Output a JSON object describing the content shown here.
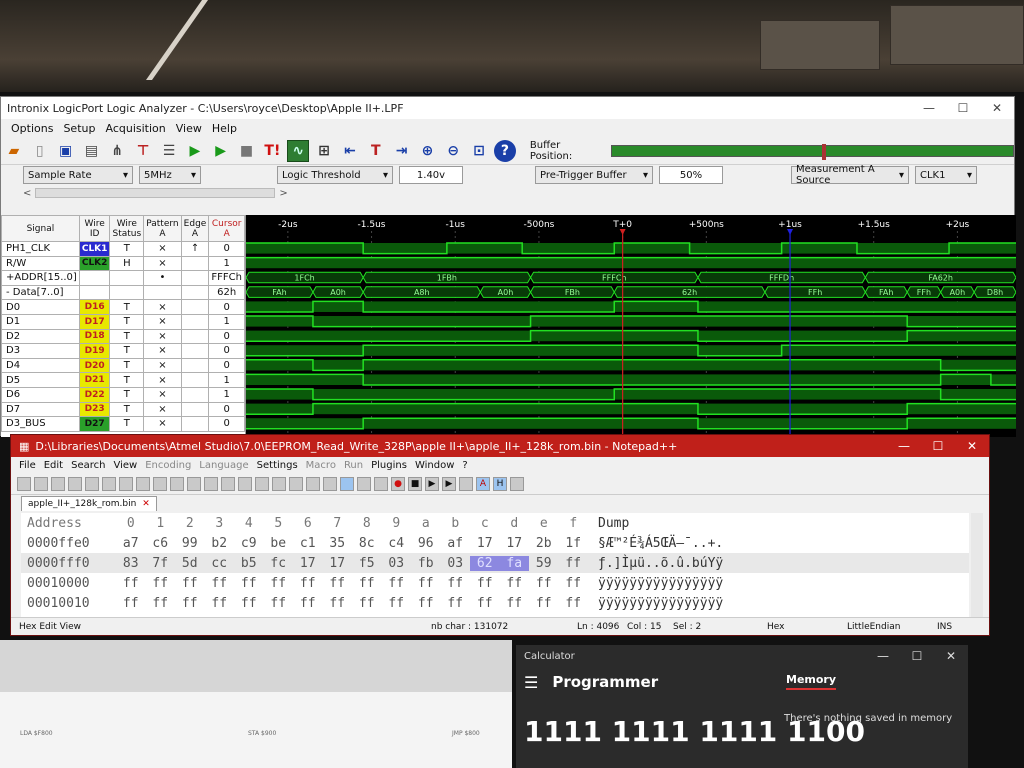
{
  "logic_analyzer": {
    "title": "Intronix LogicPort Logic Analyzer - C:\\Users\\royce\\Desktop\\Apple II+.LPF",
    "menu": [
      "Options",
      "Setup",
      "Acquisition",
      "View",
      "Help"
    ],
    "buffer_position_label": "Buffer Position:",
    "controls": {
      "sample_rate_label": "Sample Rate",
      "sample_rate_value": "5MHz",
      "logic_threshold_label": "Logic Threshold",
      "logic_threshold_value": "1.40v",
      "pretrigger_label": "Pre-Trigger Buffer",
      "pretrigger_value": "50%",
      "measurement_label": "Measurement A Source",
      "measurement_value": "CLK1"
    },
    "time_axis": [
      "-2us",
      "-1.5us",
      "-1us",
      "-500ns",
      "T+0",
      "+500ns",
      "+1us",
      "+1.5us",
      "+2us"
    ],
    "columns": [
      "Signal",
      "Wire ID",
      "Wire Status",
      "Pattern A",
      "Edge A",
      "Cursor A"
    ],
    "signals": [
      {
        "name": "PH1_CLK",
        "wire": "CLK1",
        "status": "T",
        "pattern": "×",
        "edge": "↑",
        "cursor": "0",
        "wire_color": "#2a2ad0"
      },
      {
        "name": "R/W",
        "wire": "CLK2",
        "status": "H",
        "pattern": "×",
        "edge": "",
        "cursor": "1",
        "wire_color": "#2aa02a"
      },
      {
        "name": "+ADDR[15..0]",
        "wire": "",
        "status": "",
        "pattern": "•",
        "edge": "",
        "cursor": "FFFCh",
        "wire_color": ""
      },
      {
        "name": "- Data[7..0]",
        "wire": "",
        "status": "",
        "pattern": "",
        "edge": "",
        "cursor": "62h",
        "wire_color": ""
      },
      {
        "name": "D0",
        "wire": "D16",
        "status": "T",
        "pattern": "×",
        "edge": "",
        "cursor": "0",
        "wire_color": "#e8e800"
      },
      {
        "name": "D1",
        "wire": "D17",
        "status": "T",
        "pattern": "×",
        "edge": "",
        "cursor": "1",
        "wire_color": "#e8e800"
      },
      {
        "name": "D2",
        "wire": "D18",
        "status": "T",
        "pattern": "×",
        "edge": "",
        "cursor": "0",
        "wire_color": "#e8e800"
      },
      {
        "name": "D3",
        "wire": "D19",
        "status": "T",
        "pattern": "×",
        "edge": "",
        "cursor": "0",
        "wire_color": "#e8e800"
      },
      {
        "name": "D4",
        "wire": "D20",
        "status": "T",
        "pattern": "×",
        "edge": "",
        "cursor": "0",
        "wire_color": "#e8e800"
      },
      {
        "name": "D5",
        "wire": "D21",
        "status": "T",
        "pattern": "×",
        "edge": "",
        "cursor": "1",
        "wire_color": "#e8e800"
      },
      {
        "name": "D6",
        "wire": "D22",
        "status": "T",
        "pattern": "×",
        "edge": "",
        "cursor": "1",
        "wire_color": "#e8e800"
      },
      {
        "name": "D7",
        "wire": "D23",
        "status": "T",
        "pattern": "×",
        "edge": "",
        "cursor": "0",
        "wire_color": "#e8e800"
      },
      {
        "name": "D3_BUS",
        "wire": "D27",
        "status": "T",
        "pattern": "×",
        "edge": "",
        "cursor": "0",
        "wire_color": "#2aa02a"
      }
    ],
    "addr_labels": [
      "1FCh",
      "1FBh",
      "FFFCh",
      "FFFDh",
      "FA62h"
    ],
    "data_labels": [
      "FAh",
      "A0h",
      "A8h",
      "A0h",
      "FBh",
      "62h",
      "FFh",
      "FAh",
      "FFh",
      "A0h",
      "D8h"
    ]
  },
  "notepad": {
    "title": "D:\\Libraries\\Documents\\Atmel Studio\\7.0\\EEPROM_Read_Write_328P\\apple II+\\apple_II+_128k_rom.bin - Notepad++",
    "menu": [
      "File",
      "Edit",
      "Search",
      "View",
      "Encoding",
      "Language",
      "Settings",
      "Macro",
      "Run",
      "Plugins",
      "Window",
      "?"
    ],
    "tab": "apple_II+_128k_rom.bin",
    "header": {
      "address": "Address",
      "cols": [
        "0",
        "1",
        "2",
        "3",
        "4",
        "5",
        "6",
        "7",
        "8",
        "9",
        "a",
        "b",
        "c",
        "d",
        "e",
        "f"
      ],
      "dump": "Dump"
    },
    "rows": [
      {
        "addr": "0000ffe0",
        "bytes": [
          "a7",
          "c6",
          "99",
          "b2",
          "c9",
          "be",
          "c1",
          "35",
          "8c",
          "c4",
          "96",
          "af",
          "17",
          "17",
          "2b",
          "1f"
        ],
        "dump": "§Æ™²É¾Á5ŒÄ–¯..+."
      },
      {
        "addr": "0000fff0",
        "bytes": [
          "83",
          "7f",
          "5d",
          "cc",
          "b5",
          "fc",
          "17",
          "17",
          "f5",
          "03",
          "fb",
          "03",
          "62",
          "fa",
          "59",
          "ff"
        ],
        "dump": "ƒ.]Ìµü..õ.û.búYÿ"
      },
      {
        "addr": "00010000",
        "bytes": [
          "ff",
          "ff",
          "ff",
          "ff",
          "ff",
          "ff",
          "ff",
          "ff",
          "ff",
          "ff",
          "ff",
          "ff",
          "ff",
          "ff",
          "ff",
          "ff"
        ],
        "dump": "ÿÿÿÿÿÿÿÿÿÿÿÿÿÿÿÿ"
      },
      {
        "addr": "00010010",
        "bytes": [
          "ff",
          "ff",
          "ff",
          "ff",
          "ff",
          "ff",
          "ff",
          "ff",
          "ff",
          "ff",
          "ff",
          "ff",
          "ff",
          "ff",
          "ff",
          "ff"
        ],
        "dump": "ÿÿÿÿÿÿÿÿÿÿÿÿÿÿÿÿ"
      }
    ],
    "status": {
      "mode": "Hex Edit View",
      "nb_char": "nb char : 131072",
      "ln": "Ln : 4096",
      "col": "Col : 15",
      "sel": "Sel : 2",
      "type": "Hex",
      "endian": "LittleEndian",
      "ins": "INS"
    }
  },
  "calculator": {
    "title": "Calculator",
    "mode": "Programmer",
    "memory_tab": "Memory",
    "memory_message": "There's nothing saved in memory",
    "display": "1111 1111 1111 1100"
  },
  "lower_window": {
    "labels": [
      "LDA $F800",
      "STA $900",
      "JMP $800"
    ]
  },
  "colors": {
    "trace": "#22e022",
    "cursor_a": "#d02020",
    "cursor_b": "#2020e0",
    "npp_title": "#c0201a",
    "hex_highlight": "#8c88e0"
  }
}
